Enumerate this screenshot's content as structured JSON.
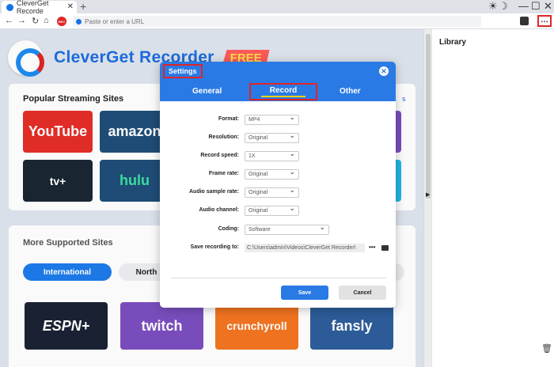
{
  "browser": {
    "tab_title": "CleverGet Recorde",
    "new_tab": "+",
    "address_placeholder": "Paste or enter a URL",
    "rec_badge": "REC"
  },
  "main": {
    "brand_name": "CleverGet Recorder",
    "brand_badge": "FREE",
    "popular_title": "Popular Streaming Sites",
    "popular_more": "s",
    "popular_sites": [
      "YouTube",
      "amazon",
      "tv+",
      "hulu"
    ],
    "supported_title": "More Supported Sites",
    "region_tabs": [
      "International",
      "North"
    ],
    "supported_sites": [
      "ESPN+",
      "twitch",
      "crunchyroll",
      "fansly"
    ]
  },
  "library": {
    "title": "Library"
  },
  "settings": {
    "title": "Settings",
    "tabs": [
      "General",
      "Record",
      "Other"
    ],
    "active_tab": "Record",
    "fields": [
      {
        "label": "Format:",
        "value": "MP4"
      },
      {
        "label": "Resolution:",
        "value": "Original"
      },
      {
        "label": "Record speed:",
        "value": "1X"
      },
      {
        "label": "Frame rate:",
        "value": "Original"
      },
      {
        "label": "Audio sample rate:",
        "value": "Original"
      },
      {
        "label": "Audio channel:",
        "value": "Original"
      },
      {
        "label": "Coding:",
        "value": "Software"
      }
    ],
    "save_path_label": "Save recording to:",
    "save_path": "C:\\Users\\admin\\Videos\\CleverGet Recorder\\",
    "browse_label": "•••",
    "save_button": "Save",
    "cancel_button": "Cancel"
  },
  "colors": {
    "accent": "#2a7ae5",
    "highlight": "#e02525",
    "youtube": "#e52d27",
    "amazon": "#1f4e79",
    "appletv": "#1b2633",
    "hulu": "#1f4e79",
    "espn": "#1a2233",
    "twitch": "#7b4fbf",
    "crunchyroll": "#f47521",
    "fansly": "#2d5d9b"
  }
}
